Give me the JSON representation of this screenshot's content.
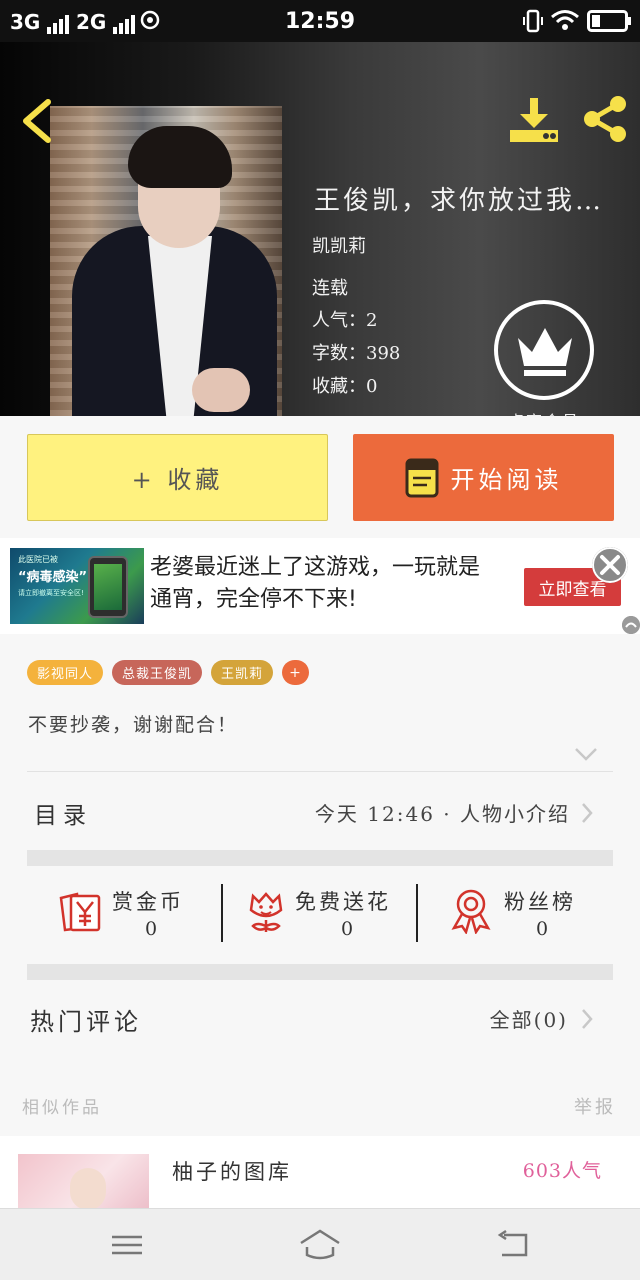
{
  "status_bar": {
    "net1": "3G",
    "net2": "2G",
    "time": "12:59"
  },
  "book": {
    "title": "王俊凯，求你放过我…",
    "author": "凯凯莉",
    "status": "连载",
    "popularity_label": "人气：2",
    "word_count_label": "字数：398",
    "collections_label": "收藏：0"
  },
  "vip": {
    "label": "点亮会员"
  },
  "actions": {
    "collect_label": "+ 收藏",
    "read_label": "开始阅读"
  },
  "ad": {
    "image_top": "此医院已被",
    "image_title": "“病毒感染”",
    "image_bottom": "请立即撤离至安全区!",
    "text": "老婆最近迷上了这游戏，一玩就是通宵，完全停不下来!",
    "button": "立即查看"
  },
  "tags": [
    {
      "label": "影视同人",
      "color": "#f4b23c"
    },
    {
      "label": "总裁王俊凯",
      "color": "#c7665a"
    },
    {
      "label": "王凯莉",
      "color": "#d4a43a"
    }
  ],
  "tag_more": "+",
  "notice": "不要抄袭，谢谢配合！",
  "toc": {
    "label": "目录",
    "latest": "今天 12:46 · 人物小介绍"
  },
  "support": [
    {
      "name": "赏金币",
      "value": "0"
    },
    {
      "name": "免费送花",
      "value": "0"
    },
    {
      "name": "粉丝榜",
      "value": "0"
    }
  ],
  "comments": {
    "label": "热门评论",
    "all": "全部(0)"
  },
  "similar": {
    "label": "相似作品",
    "report": "举报",
    "items": [
      {
        "title": "柚子的图库",
        "popularity": "603人气"
      }
    ]
  },
  "colors": {
    "accent_orange": "#ec6a3c",
    "collect_yellow": "#fff27f",
    "icon_red": "#d2332b",
    "toolbar_yellow": "#f6e04a"
  },
  "icons": [
    "back-icon",
    "download-icon",
    "share-icon",
    "crown-icon",
    "book-icon",
    "coin-envelope-icon",
    "flower-icon",
    "medal-icon",
    "menu-icon",
    "home-icon",
    "return-icon"
  ]
}
